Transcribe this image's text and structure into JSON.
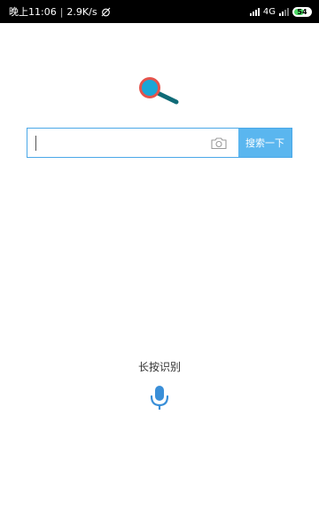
{
  "status_bar": {
    "time": "晚上11:06",
    "speed": "2.9K/s",
    "network_type": "4G",
    "battery_level": "54"
  },
  "icons": {
    "logo": "magnifier-logo-icon",
    "camera": "camera-icon",
    "mic": "microphone-icon"
  },
  "colors": {
    "accent": "#5ab6ef",
    "border": "#4aa8e8",
    "logo_ring": "#e5534b",
    "logo_lens": "#1aa6d6",
    "logo_handle": "#0f6b77",
    "mic": "#3a8fd8"
  },
  "search": {
    "value": "",
    "placeholder": "",
    "button_label": "搜索一下"
  },
  "voice": {
    "label": "长按识别"
  }
}
